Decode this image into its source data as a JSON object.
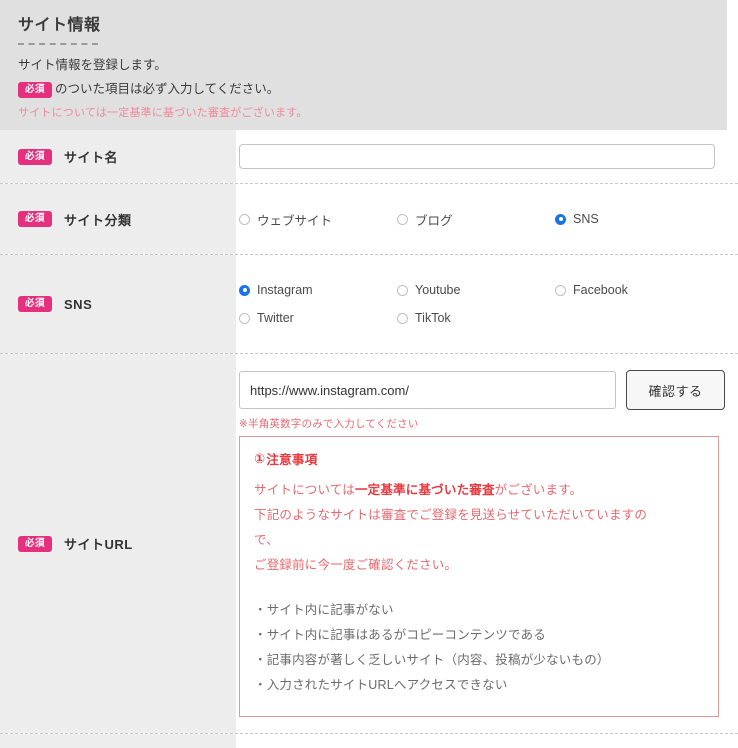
{
  "header": {
    "title": "サイト情報",
    "line1": "サイト情報を登録します。",
    "badge": "必須",
    "line2_after_badge": "のついた項目は必ず入力してください。",
    "note": "サイトについては一定基準に基づいた審査がございます。"
  },
  "rows": {
    "sitename": {
      "badge": "必須",
      "label": "サイト名",
      "value": "",
      "placeholder": ""
    },
    "category": {
      "badge": "必須",
      "label": "サイト分類",
      "options": [
        {
          "label": "ウェブサイト",
          "checked": false
        },
        {
          "label": "ブログ",
          "checked": false
        },
        {
          "label": "SNS",
          "checked": true
        }
      ]
    },
    "sns": {
      "badge": "必須",
      "label": "SNS",
      "options": [
        {
          "label": "Instagram",
          "checked": true
        },
        {
          "label": "Youtube",
          "checked": false
        },
        {
          "label": "Facebook",
          "checked": false
        },
        {
          "label": "Twitter",
          "checked": false
        },
        {
          "label": "TikTok",
          "checked": false
        }
      ]
    },
    "siteurl": {
      "badge": "必須",
      "label": "サイトURL",
      "value": "https://www.instagram.com/",
      "placeholder": "",
      "confirm_button": "確認する",
      "hint": "※半角英数字のみで入力してください",
      "notice": {
        "icon": "⚠",
        "title": "注意事項",
        "para1_pre": "サイトについては",
        "para1_strong": "一定基準に基づいた審査",
        "para1_post": "がございます。",
        "para2": "下記のようなサイトは審査でご登録を見送らせていただいていますの",
        "para3": "で、",
        "para4": "ご登録前に今一度ご確認ください。",
        "items": [
          "・サイト内に記事がない",
          "・サイト内に記事はあるがコピーコンテンツである",
          "・記事内容が著しく乏しいサイト（内容、投稿が少ないもの）",
          "・入力されたサイトURLへアクセスできない"
        ]
      }
    }
  },
  "colors": {
    "badge_pink": "#e5317d",
    "radio_blue": "#1a73e8",
    "notice_red": "#e8393f",
    "notice_text": "#e8686e",
    "header_bg": "#e0e0e0",
    "label_bg": "#ededed"
  }
}
